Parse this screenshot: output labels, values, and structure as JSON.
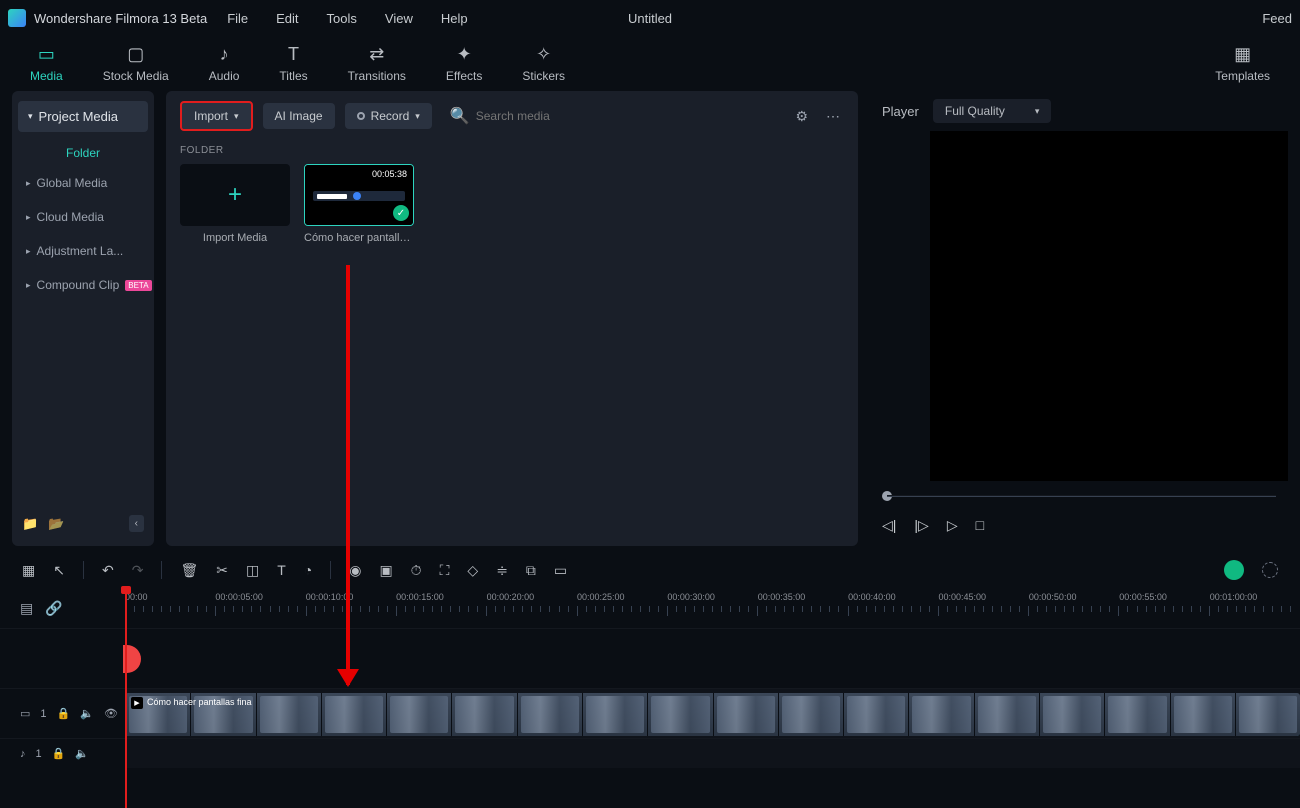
{
  "app": {
    "name": "Wondershare Filmora 13 Beta",
    "doc": "Untitled",
    "right_btn": "Feed"
  },
  "menu": [
    "File",
    "Edit",
    "Tools",
    "View",
    "Help"
  ],
  "tabs": [
    {
      "label": "Media",
      "glyph": "▭",
      "active": true
    },
    {
      "label": "Stock Media",
      "glyph": "▢"
    },
    {
      "label": "Audio",
      "glyph": "♪"
    },
    {
      "label": "Titles",
      "glyph": "T"
    },
    {
      "label": "Transitions",
      "glyph": "⇄"
    },
    {
      "label": "Effects",
      "glyph": "✦"
    },
    {
      "label": "Stickers",
      "glyph": "✧"
    },
    {
      "label": "Templates",
      "glyph": "▦"
    }
  ],
  "sidebar": {
    "project_media": "Project Media",
    "folder_label": "Folder",
    "items": [
      {
        "label": "Global Media"
      },
      {
        "label": "Cloud Media"
      },
      {
        "label": "Adjustment La..."
      },
      {
        "label": "Compound Clip",
        "tag": "BETA"
      }
    ]
  },
  "mediabar": {
    "import": "Import",
    "ai_image": "AI Image",
    "record": "Record",
    "search_placeholder": "Search media"
  },
  "folder_header": "FOLDER",
  "thumbs": {
    "import_media": "Import Media",
    "clip": {
      "duration": "00:05:38",
      "label": "Cómo hacer pantallas ..."
    }
  },
  "player": {
    "label": "Player",
    "quality": "Full Quality"
  },
  "ruler": [
    "00:00",
    "00:00:05:00",
    "00:00:10:00",
    "00:00:15:00",
    "00:00:20:00",
    "00:00:25:00",
    "00:00:30:00",
    "00:00:35:00",
    "00:00:40:00",
    "00:00:45:00",
    "00:00:50:00",
    "00:00:55:00",
    "00:01:00:00"
  ],
  "clip_title": "Cómo hacer pantallas fina",
  "track_labels": {
    "video": "1",
    "audio": "1"
  }
}
